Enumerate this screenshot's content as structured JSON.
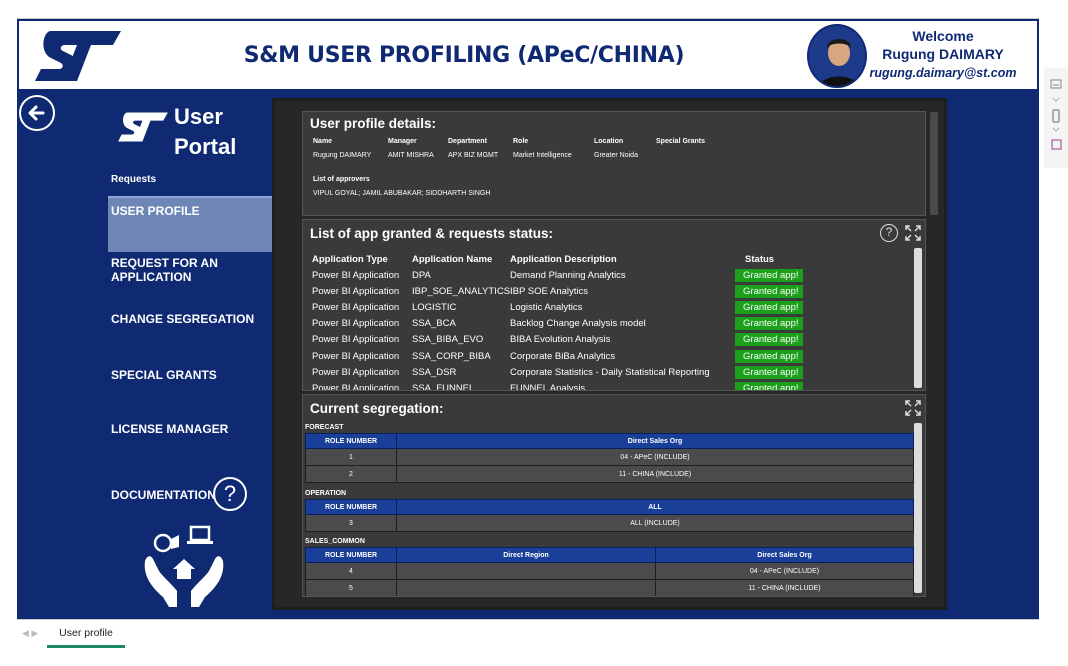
{
  "header": {
    "title": "S&M USER PROFILING (APeC/CHINA)",
    "welcome": "Welcome",
    "user_name": "Rugung DAIMARY",
    "user_email": "rugung.daimary@st.com"
  },
  "sidebar": {
    "portal_title_line1": "User",
    "portal_title_line2": "Portal",
    "section_label": "Requests",
    "items": [
      {
        "label": "USER PROFILE",
        "active": true
      },
      {
        "label": "REQUEST FOR AN APPLICATION"
      },
      {
        "label": "CHANGE SEGREGATION"
      },
      {
        "label": "SPECIAL GRANTS"
      },
      {
        "label": "LICENSE MANAGER"
      },
      {
        "label": "DOCUMENTATION"
      }
    ],
    "help_glyph": "?"
  },
  "profile": {
    "title": "User profile details:",
    "headers": [
      "Name",
      "Manager",
      "Department",
      "Role",
      "Location",
      "Special Grants"
    ],
    "values": [
      "Rugung DAIMARY",
      "AMIT MISHRA",
      "APX BIZ MGMT",
      "Market Intelligence",
      "Greater Noida",
      ""
    ],
    "approvers_label": "List of approvers",
    "approvers_value": "VIPUL GOYAL; JAMIL ABUBAKAR; SIDDHARTH SINGH"
  },
  "apps": {
    "title": "List of app granted & requests status:",
    "columns": [
      "Application Type",
      "Application Name",
      "Application Description",
      "Status"
    ],
    "rows": [
      [
        "Power BI Application",
        "DPA",
        "Demand Planning Analytics",
        "Granted app!"
      ],
      [
        "Power BI Application",
        "IBP_SOE_ANALYTICS",
        "IBP SOE Analytics",
        "Granted app!"
      ],
      [
        "Power BI Application",
        "LOGISTIC",
        "Logistic Analytics",
        "Granted app!"
      ],
      [
        "Power BI Application",
        "SSA_BCA",
        "Backlog Change Analysis model",
        "Granted app!"
      ],
      [
        "Power BI Application",
        "SSA_BIBA_EVO",
        "BIBA Evolution Analysis",
        "Granted app!"
      ],
      [
        "Power BI Application",
        "SSA_CORP_BIBA",
        "Corporate BiBa Analytics",
        "Granted app!"
      ],
      [
        "Power BI Application",
        "SSA_DSR",
        "Corporate Statistics - Daily Statistical Reporting",
        "Granted app!"
      ],
      [
        "Power BI Application",
        "SSA_FUNNEL",
        "FUNNEL Analysis",
        "Granted app!"
      ]
    ]
  },
  "segregation": {
    "title": "Current segregation:",
    "forecast": {
      "label": "FORECAST",
      "headers": [
        "ROLE NUMBER",
        "Direct Sales Org"
      ],
      "rows": [
        [
          "1",
          "04 - APeC (INCLUDE)"
        ],
        [
          "2",
          "11 - CHINA (INCLUDE)"
        ]
      ]
    },
    "operation": {
      "label": "OPERATION",
      "headers": [
        "ROLE NUMBER",
        "ALL"
      ],
      "rows": [
        [
          "3",
          "ALL (INCLUDE)"
        ]
      ]
    },
    "sales_common": {
      "label": "SALES_COMMON",
      "headers": [
        "ROLE NUMBER",
        "Direct Region",
        "Direct Sales Org"
      ],
      "rows": [
        [
          "4",
          "",
          "04 - APeC (INCLUDE)"
        ],
        [
          "5",
          "",
          "11 - CHINA (INCLUDE)"
        ]
      ]
    }
  },
  "footer": {
    "tab_label": "User profile"
  },
  "colors": {
    "brand_navy": "#0f2a73",
    "granted_green": "#1ca01c",
    "table_header_blue": "#1a3f99"
  }
}
